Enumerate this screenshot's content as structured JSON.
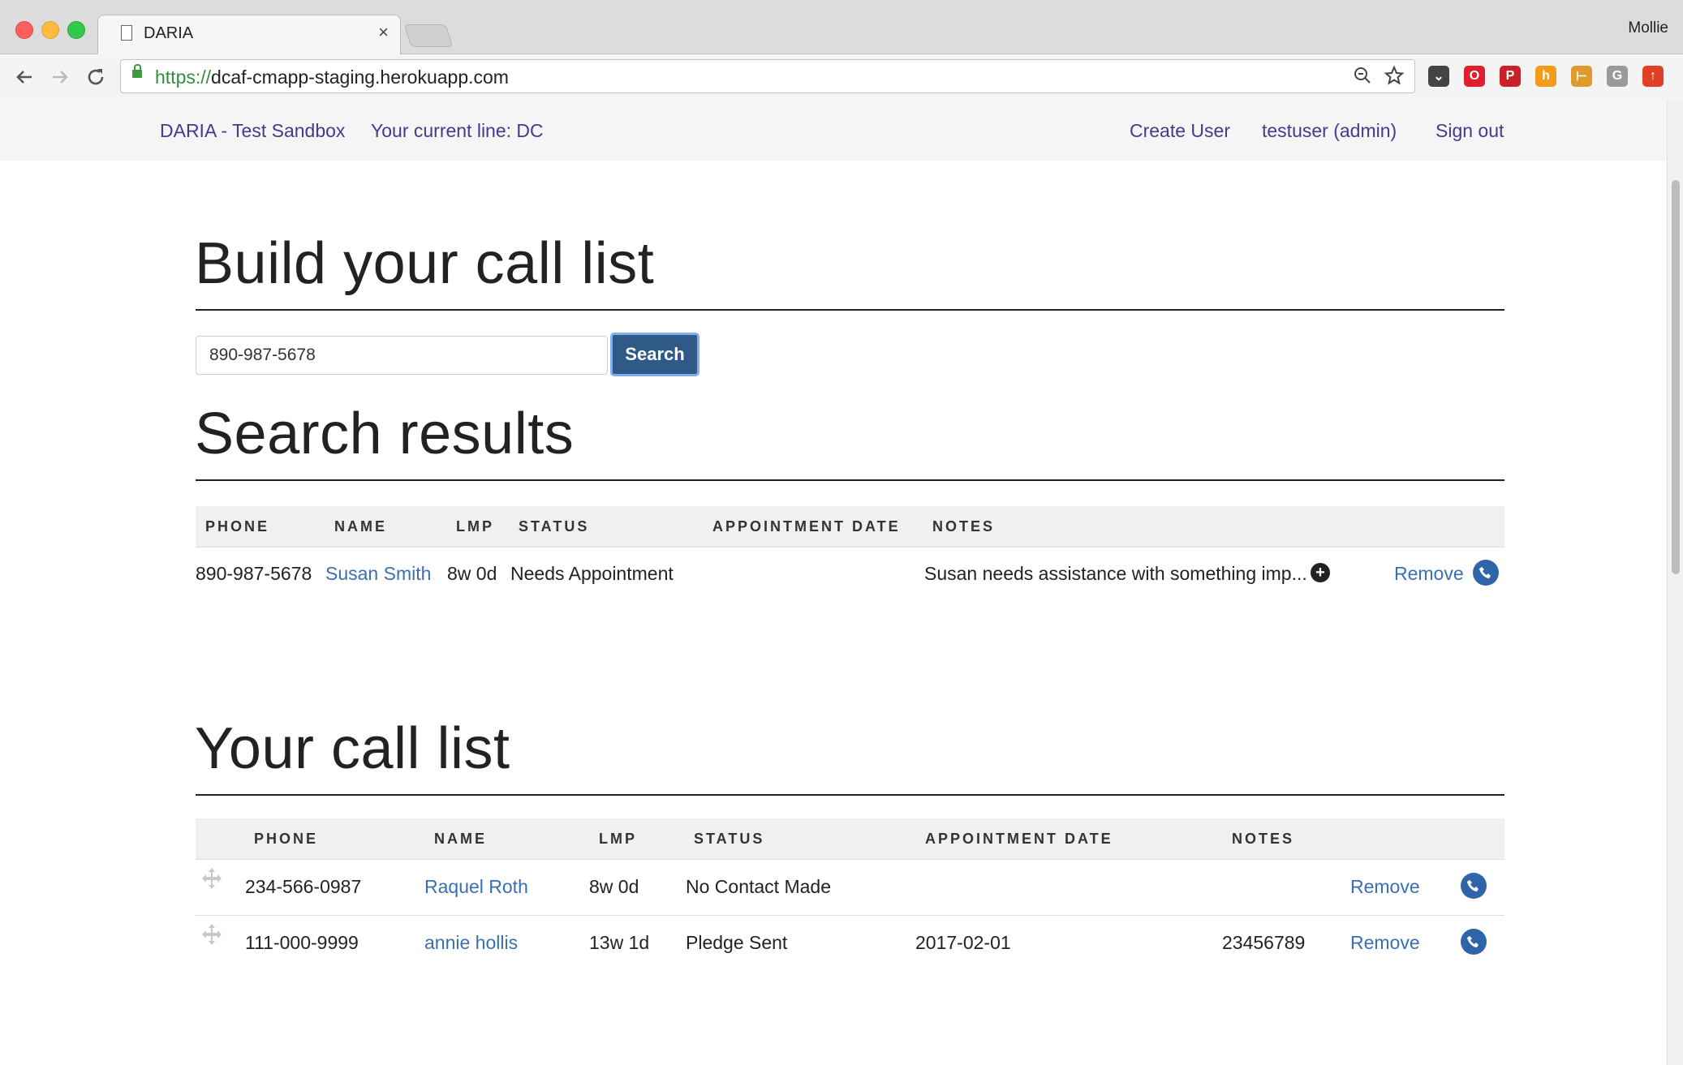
{
  "browser": {
    "tab_title": "DARIA",
    "tab_close": "×",
    "profile_name": "Mollie",
    "url_scheme": "https://",
    "url_host": "dcaf-cmapp-staging.herokuapp.com",
    "extensions": [
      {
        "name": "pocket",
        "color": "#444444",
        "glyph": "⌄"
      },
      {
        "name": "opera",
        "color": "#e0202e",
        "glyph": "O"
      },
      {
        "name": "pinterest",
        "color": "#cb2027",
        "glyph": "P"
      },
      {
        "name": "honey",
        "color": "#f39c1a",
        "glyph": "h"
      },
      {
        "name": "tag",
        "color": "#e09a2b",
        "glyph": "⊢"
      },
      {
        "name": "grammarly",
        "color": "#9a9a9a",
        "glyph": "G"
      },
      {
        "name": "upload",
        "color": "#e14027",
        "glyph": "↑"
      }
    ]
  },
  "appnav": {
    "brand": "DARIA - Test Sandbox",
    "current_line": "Your current line: DC",
    "create_user": "Create User",
    "user": "testuser (admin)",
    "sign_out": "Sign out"
  },
  "build": {
    "heading": "Build your call list",
    "search_value": "890-987-5678",
    "search_button": "Search"
  },
  "results": {
    "heading": "Search results",
    "columns": [
      "PHONE",
      "NAME",
      "LMP",
      "STATUS",
      "APPOINTMENT DATE",
      "NOTES"
    ],
    "rows": [
      {
        "phone": "890-987-5678",
        "name": "Susan Smith",
        "lmp": "8w 0d",
        "status": "Needs Appointment",
        "appointment": "",
        "notes": "Susan needs assistance with something imp...",
        "action": "Remove"
      }
    ]
  },
  "calllist": {
    "heading": "Your call list",
    "columns": [
      "PHONE",
      "NAME",
      "LMP",
      "STATUS",
      "APPOINTMENT DATE",
      "NOTES"
    ],
    "rows": [
      {
        "phone": "234-566-0987",
        "name": "Raquel Roth",
        "lmp": "8w 0d",
        "status": "No Contact Made",
        "appointment": "",
        "notes": "",
        "action": "Remove"
      },
      {
        "phone": "111-000-9999",
        "name": "annie hollis",
        "lmp": "13w 1d",
        "status": "Pledge Sent",
        "appointment": "2017-02-01",
        "notes": "23456789",
        "action": "Remove"
      }
    ]
  },
  "colors": {
    "link": "#3a6fb0",
    "nav_link": "#3f3d8c",
    "search_button": "#2f5a88",
    "phone_button": "#2f65a8"
  }
}
